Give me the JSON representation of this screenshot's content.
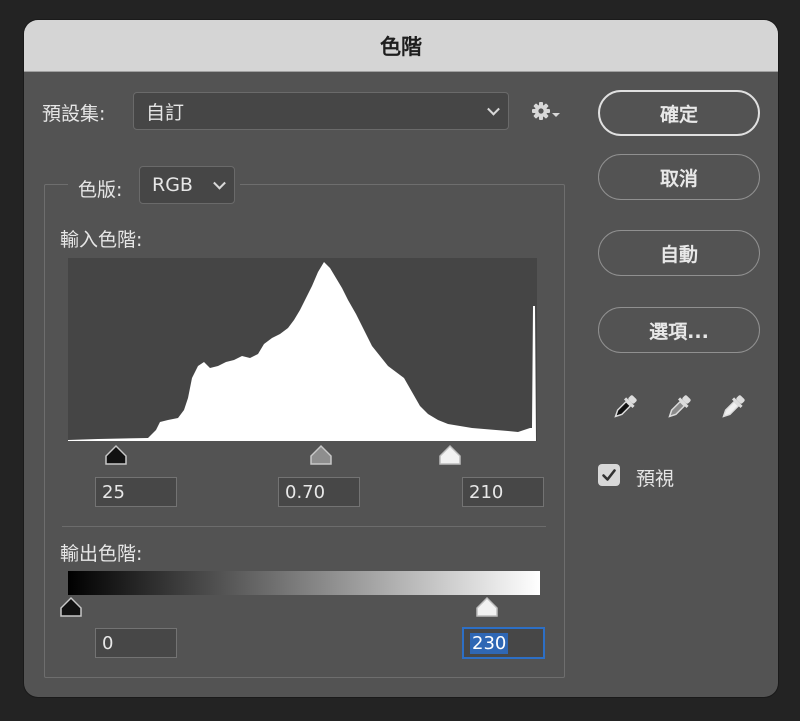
{
  "title": "色階",
  "preset": {
    "label": "預設集:",
    "value": "自訂"
  },
  "channel": {
    "label": "色版:",
    "value": "RGB"
  },
  "input_levels": {
    "label": "輸入色階:",
    "black": "25",
    "gamma": "0.70",
    "white": "210"
  },
  "output_levels": {
    "label": "輸出色階:",
    "black": "0",
    "white": "230"
  },
  "buttons": {
    "ok": "確定",
    "cancel": "取消",
    "auto": "自動",
    "options": "選項..."
  },
  "preview": {
    "label": "預視",
    "checked": true
  },
  "icons": [
    "gear-icon",
    "black-eyedropper-icon",
    "gray-eyedropper-icon",
    "white-eyedropper-icon",
    "chevron-down-icon",
    "checkmark-icon"
  ],
  "colors": {
    "dialog_bg": "#535353",
    "titlebar": "#d5d5d5",
    "histogram_bg": "#454545",
    "histogram_fill": "#ffffff",
    "highlight": "#2f67b4"
  }
}
